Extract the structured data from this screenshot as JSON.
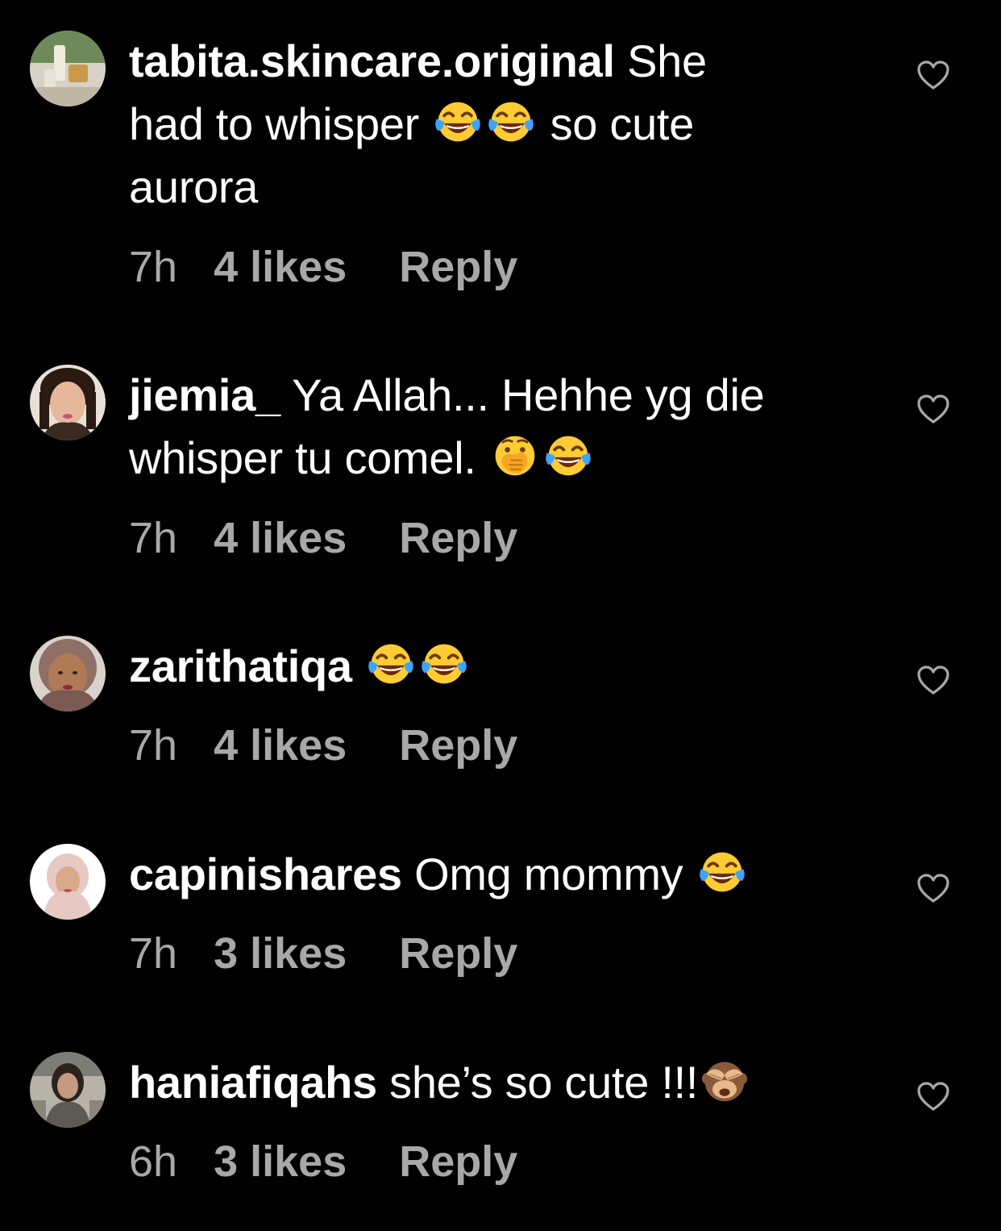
{
  "comments": [
    {
      "username": "tabita.skincare.original",
      "text_parts": [
        "She had to whisper ",
        "joy",
        "joy",
        " so cute aurora"
      ],
      "text_a": "She",
      "text_b": "had to whisper",
      "text_c": "so cute",
      "text_d": "aurora",
      "time": "7h",
      "likes": "4 likes",
      "reply": "Reply",
      "emojis": [
        "face-with-tears-of-joy",
        "face-with-tears-of-joy"
      ]
    },
    {
      "username": "jiemia_",
      "text_a": "Ya Allah... Hehhe yg die",
      "text_b": "whisper tu comel.",
      "time": "7h",
      "likes": "4 likes",
      "reply": "Reply",
      "emojis": [
        "face-with-hand-over-mouth",
        "face-with-tears-of-joy"
      ]
    },
    {
      "username": "zarithatiqa",
      "time": "7h",
      "likes": "4 likes",
      "reply": "Reply",
      "emojis": [
        "face-with-tears-of-joy",
        "face-with-tears-of-joy"
      ]
    },
    {
      "username": "capinishares",
      "text_a": "Omg mommy",
      "time": "7h",
      "likes": "3 likes",
      "reply": "Reply",
      "emojis": [
        "face-with-tears-of-joy"
      ]
    },
    {
      "username": "haniafiqahs",
      "text_a": "she’s so cute !!!",
      "time": "6h",
      "likes": "3 likes",
      "reply": "Reply",
      "emojis": [
        "see-no-evil-monkey"
      ]
    }
  ],
  "colors": {
    "background": "#000000",
    "text": "#ffffff",
    "meta": "#a8a8a8"
  },
  "icons": {
    "like": "heart-outline-icon"
  }
}
